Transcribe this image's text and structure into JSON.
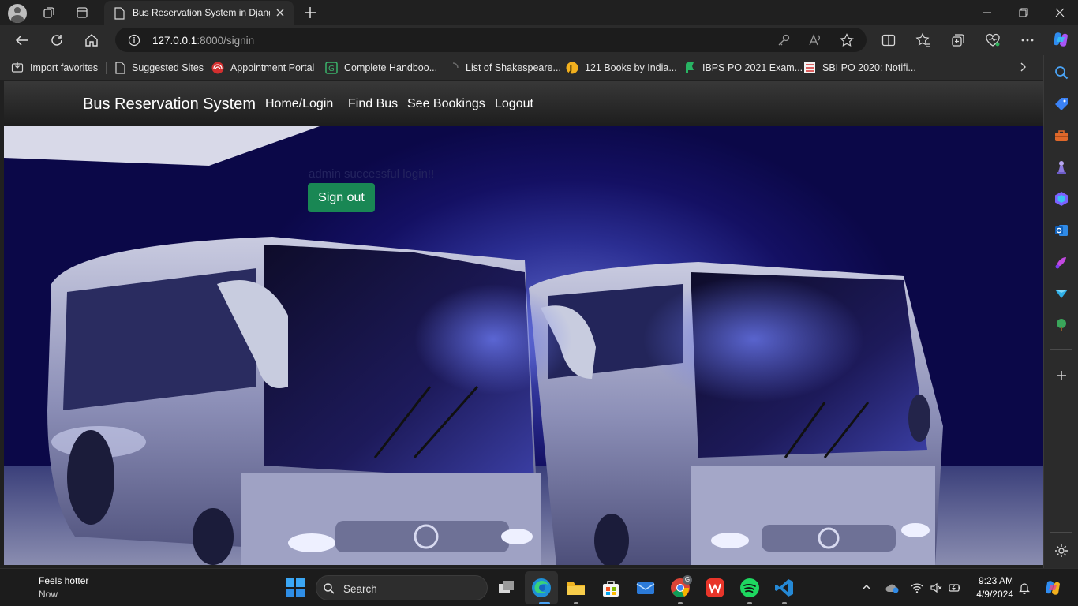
{
  "browser": {
    "tab_title": "Bus Reservation System in Django",
    "url_host": "127.0.0.1",
    "url_rest": ":8000/signin"
  },
  "favorites": [
    {
      "label": "Import favorites",
      "icon": "import-icon"
    },
    {
      "label": "Suggested Sites",
      "icon": "page-icon"
    },
    {
      "label": "Appointment Portal",
      "icon": "portal-icon"
    },
    {
      "label": "Complete Handboo...",
      "icon": "handbook-icon"
    },
    {
      "label": "List of Shakespeare...",
      "icon": "loading-icon"
    },
    {
      "label": "121 Books by India...",
      "icon": "books-icon"
    },
    {
      "label": "IBPS PO 2021 Exam...",
      "icon": "ibps-icon"
    },
    {
      "label": "SBI PO 2020: Notifi...",
      "icon": "sbi-icon"
    }
  ],
  "site": {
    "brand": "Bus Reservation System",
    "nav": [
      "Home/Login",
      "Find Bus",
      "See Bookings",
      "Logout"
    ],
    "message": "admin successful login!!",
    "signout_label": "Sign out"
  },
  "taskbar": {
    "weather_title": "Feels hotter",
    "weather_sub": "Now",
    "search_label": "Search",
    "time": "9:23 AM",
    "date": "4/9/2024",
    "chrome_badge": "G"
  },
  "colors": {
    "signout_button": "#198754",
    "navbar": "#2a2a2a",
    "hero_background": "#141063"
  }
}
